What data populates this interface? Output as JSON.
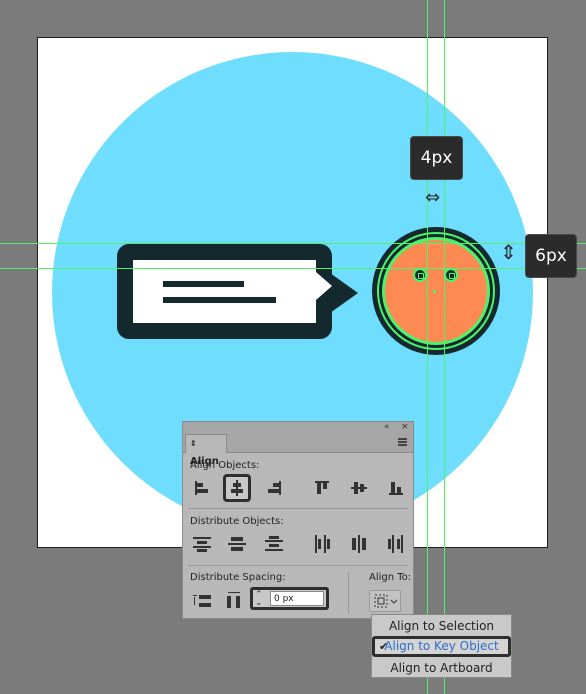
{
  "canvas": {
    "colors": {
      "background": "#7b7b7b",
      "artboard": "#ffffff",
      "circle": "#6fddfd",
      "dark": "#14292d",
      "face": "#fc8a52",
      "guide": "#4cf36b"
    }
  },
  "tooltips": {
    "horizontal_gap": "4px",
    "vertical_gap": "6px"
  },
  "panel": {
    "title": "Align",
    "align_objects_label": "Align Objects:",
    "distribute_objects_label": "Distribute Objects:",
    "distribute_spacing_label": "Distribute Spacing:",
    "align_to_label": "Align To:",
    "spacing_value": "0 px",
    "collapse_glyph": "«",
    "close_glyph": "×"
  },
  "dropdown": {
    "items": [
      {
        "label": "Align to Selection",
        "checked": false
      },
      {
        "label": "Align to Key Object",
        "checked": true
      },
      {
        "label": "Align to Artboard",
        "checked": false
      }
    ],
    "check_glyph": "✔"
  }
}
